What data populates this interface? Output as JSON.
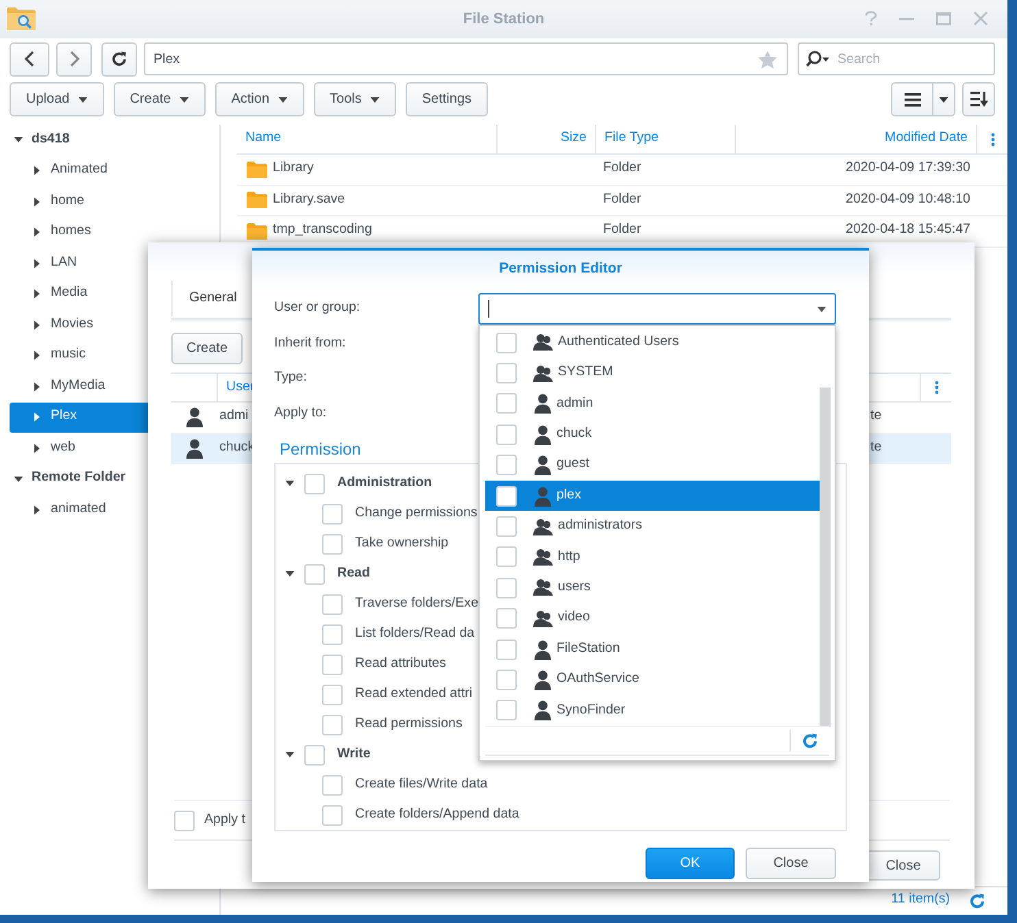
{
  "window": {
    "title": "File Station"
  },
  "navigation": {
    "path": "Plex",
    "search_placeholder": "Search"
  },
  "toolbar": [
    {
      "label": "Upload",
      "kind": "menu"
    },
    {
      "label": "Create",
      "kind": "menu"
    },
    {
      "label": "Action",
      "kind": "menu"
    },
    {
      "label": "Tools",
      "kind": "menu"
    },
    {
      "label": "Settings",
      "kind": "plain"
    }
  ],
  "sidebar": {
    "items": [
      {
        "label": "ds418",
        "expanded": true,
        "selected": false,
        "children": [
          {
            "label": "Animated",
            "expanded": false,
            "selected": false
          },
          {
            "label": "home",
            "expanded": false,
            "selected": false
          },
          {
            "label": "homes",
            "expanded": false,
            "selected": false
          },
          {
            "label": "LAN",
            "expanded": false,
            "selected": false
          },
          {
            "label": "Media",
            "expanded": false,
            "selected": false
          },
          {
            "label": "Movies",
            "expanded": false,
            "selected": false
          },
          {
            "label": "music",
            "expanded": false,
            "selected": false
          },
          {
            "label": "MyMedia",
            "expanded": false,
            "selected": false
          },
          {
            "label": "Plex",
            "expanded": false,
            "selected": true
          },
          {
            "label": "web",
            "expanded": false,
            "selected": false
          }
        ]
      },
      {
        "label": "Remote Folder",
        "expanded": true,
        "selected": false,
        "children": [
          {
            "label": "animated",
            "expanded": false,
            "selected": false
          }
        ]
      }
    ]
  },
  "file_list": {
    "columns": [
      "Name",
      "Size",
      "File Type",
      "Modified Date"
    ],
    "rows": [
      {
        "name": "Library",
        "type": "Folder",
        "modified": "2020-04-09 17:39:30"
      },
      {
        "name": "Library.save",
        "type": "Folder",
        "modified": "2020-04-09 10:48:10"
      },
      {
        "name": "tmp_transcoding",
        "type": "Folder",
        "modified": "2020-04-18 15:45:47"
      }
    ],
    "status": "11 item(s)"
  },
  "properties_dialog": {
    "tabs": [
      {
        "label": "General",
        "selected": true
      }
    ],
    "create_button": "Create",
    "columns": [
      "User"
    ],
    "rows": [
      {
        "name": "admi",
        "column_3": "te",
        "selected": false
      },
      {
        "name": "chuck",
        "column_3": "te",
        "selected": true
      }
    ],
    "apply_to": {
      "label": "Apply t",
      "checked": false
    },
    "close_button": "Close"
  },
  "permission_editor": {
    "title": "Permission Editor",
    "fields": [
      {
        "label": "User or group:",
        "kind": "combo"
      },
      {
        "label": "Inherit from:",
        "kind": "text"
      },
      {
        "label": "Type:",
        "kind": "text"
      },
      {
        "label": "Apply to:",
        "kind": "text"
      }
    ],
    "permission_heading": "Permission",
    "permissions": [
      {
        "label": "Administration",
        "checked": false,
        "expanded": true,
        "children": [
          {
            "label": "Change permissions",
            "checked": false
          },
          {
            "label": "Take ownership",
            "checked": false
          }
        ]
      },
      {
        "label": "Read",
        "checked": false,
        "expanded": true,
        "children": [
          {
            "label": "Traverse folders/Exe",
            "checked": false
          },
          {
            "label": "List folders/Read da",
            "checked": false
          },
          {
            "label": "Read attributes",
            "checked": false
          },
          {
            "label": "Read extended attri",
            "checked": false
          },
          {
            "label": "Read permissions",
            "checked": false
          }
        ]
      },
      {
        "label": "Write",
        "checked": false,
        "expanded": true,
        "children": [
          {
            "label": "Create files/Write data",
            "checked": false
          },
          {
            "label": "Create folders/Append data",
            "checked": false
          }
        ]
      }
    ],
    "buttons": [
      {
        "label": "OK",
        "kind": "primary"
      },
      {
        "label": "Close",
        "kind": "secondary"
      }
    ]
  },
  "user_dropdown": {
    "items": [
      {
        "label": "Authenticated Users",
        "kind": "group",
        "checked": false,
        "selected": false
      },
      {
        "label": "SYSTEM",
        "kind": "group",
        "checked": false,
        "selected": false
      },
      {
        "label": "admin",
        "kind": "user",
        "checked": false,
        "selected": false
      },
      {
        "label": "chuck",
        "kind": "user",
        "checked": false,
        "selected": false
      },
      {
        "label": "guest",
        "kind": "user",
        "checked": false,
        "selected": false
      },
      {
        "label": "plex",
        "kind": "user",
        "checked": false,
        "selected": true
      },
      {
        "label": "administrators",
        "kind": "group",
        "checked": false,
        "selected": false
      },
      {
        "label": "http",
        "kind": "group",
        "checked": false,
        "selected": false
      },
      {
        "label": "users",
        "kind": "group",
        "checked": false,
        "selected": false
      },
      {
        "label": "video",
        "kind": "group",
        "checked": false,
        "selected": false
      },
      {
        "label": "FileStation",
        "kind": "user",
        "checked": false,
        "selected": false
      },
      {
        "label": "OAuthService",
        "kind": "user",
        "checked": false,
        "selected": false
      },
      {
        "label": "SynoFinder",
        "kind": "user",
        "checked": false,
        "selected": false
      }
    ]
  }
}
